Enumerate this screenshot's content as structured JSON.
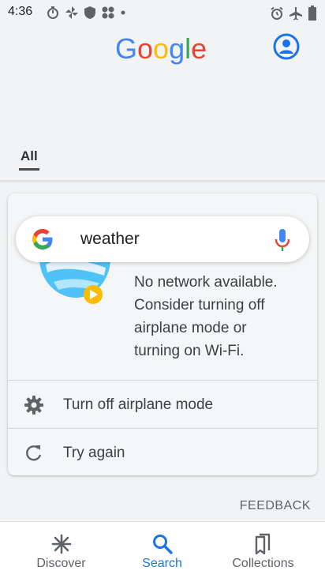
{
  "status_bar": {
    "time": "4:36"
  },
  "header": {
    "logo_letters": [
      "G",
      "o",
      "o",
      "g",
      "l",
      "e"
    ],
    "logo_colors": [
      "#4285f4",
      "#ea4335",
      "#fbbc05",
      "#4285f4",
      "#34a853",
      "#ea4335"
    ],
    "tab_all": "All"
  },
  "search": {
    "query": "weather"
  },
  "error_card": {
    "message_lines": [
      "No network available.",
      "Consider turning off",
      "airplane mode or",
      "turning on Wi-Fi."
    ],
    "actions": [
      {
        "label": "Turn off airplane mode",
        "icon": "gear-icon"
      },
      {
        "label": "Try again",
        "icon": "refresh-icon"
      }
    ]
  },
  "feedback_label": "FEEDBACK",
  "bottom_nav": {
    "items": [
      {
        "label": "Discover",
        "icon": "asterisk-icon",
        "active": false
      },
      {
        "label": "Search",
        "icon": "search-icon",
        "active": true
      },
      {
        "label": "Collections",
        "icon": "bookmarks-icon",
        "active": false
      }
    ]
  },
  "colors": {
    "accent": "#1a73e8",
    "background": "#f1f3f4"
  }
}
